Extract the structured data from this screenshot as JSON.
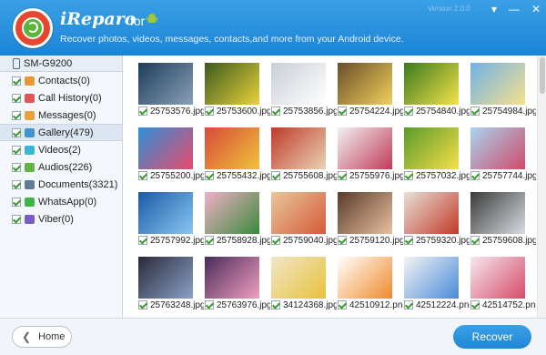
{
  "header": {
    "title": "iReparo",
    "for_text": "for",
    "subtitle": "Recover photos, videos, messages, contacts,and more from your Android device.",
    "version": "Version 2.0.0",
    "window_controls": {
      "menu": "▾",
      "minimize": "—",
      "close": "✕"
    }
  },
  "sidebar": {
    "device": "SM-G9200",
    "items": [
      {
        "label": "Contacts(0)",
        "icon": "contacts-icon",
        "color": "#e8963a"
      },
      {
        "label": "Call History(0)",
        "icon": "call-history-icon",
        "color": "#e05555"
      },
      {
        "label": "Messages(0)",
        "icon": "messages-icon",
        "color": "#e8a23a"
      },
      {
        "label": "Gallery(479)",
        "icon": "gallery-icon",
        "color": "#3d93d4",
        "active": true
      },
      {
        "label": "Videos(2)",
        "icon": "videos-icon",
        "color": "#3db4d4"
      },
      {
        "label": "Audios(226)",
        "icon": "audios-icon",
        "color": "#5fb53d"
      },
      {
        "label": "Documents(3321)",
        "icon": "documents-icon",
        "color": "#5e7c93"
      },
      {
        "label": "WhatsApp(0)",
        "icon": "whatsapp-icon",
        "color": "#3fb34a"
      },
      {
        "label": "Viber(0)",
        "icon": "viber-icon",
        "color": "#7b5cc6"
      }
    ]
  },
  "gallery": {
    "files": [
      {
        "name": "25753576.jpg",
        "colors": [
          "#1e3b5a",
          "#8aa2b8"
        ]
      },
      {
        "name": "25753600.jpg",
        "colors": [
          "#3c5a1e",
          "#e8d23a"
        ]
      },
      {
        "name": "25753856.jpg",
        "colors": [
          "#c9cfd6",
          "#ffffff"
        ]
      },
      {
        "name": "25754224.jpg",
        "colors": [
          "#6a4e2a",
          "#f0d05a"
        ]
      },
      {
        "name": "25754840.jpg",
        "colors": [
          "#3a7a1e",
          "#f4e24a"
        ]
      },
      {
        "name": "25754984.jpg",
        "colors": [
          "#6fb2e8",
          "#f6e08a"
        ]
      },
      {
        "name": "25755200.jpg",
        "colors": [
          "#2e8fd8",
          "#e84a6a"
        ]
      },
      {
        "name": "25755432.jpg",
        "colors": [
          "#d84a3a",
          "#f0c23a"
        ]
      },
      {
        "name": "25755608.jpg",
        "colors": [
          "#c03a2a",
          "#e9d3b3"
        ]
      },
      {
        "name": "25755976.jpg",
        "colors": [
          "#f2f2f2",
          "#c23a5a"
        ]
      },
      {
        "name": "25757032.jpg",
        "colors": [
          "#5a9a2a",
          "#f6e04a"
        ]
      },
      {
        "name": "25757744.jpg",
        "colors": [
          "#a8d4f0",
          "#d04a6a"
        ]
      },
      {
        "name": "25757992.jpg",
        "colors": [
          "#1a5aa8",
          "#8ac6f0"
        ]
      },
      {
        "name": "25758928.jpg",
        "colors": [
          "#f0b0c8",
          "#3a8a3a"
        ]
      },
      {
        "name": "25759040.jpg",
        "colors": [
          "#e8c89a",
          "#d65a3a"
        ]
      },
      {
        "name": "25759120.jpg",
        "colors": [
          "#5a3a2a",
          "#e8c0a0"
        ]
      },
      {
        "name": "25759320.jpg",
        "colors": [
          "#e8e0d8",
          "#c23a2a"
        ]
      },
      {
        "name": "25759608.jpg",
        "colors": [
          "#3a3a3a",
          "#d8dde2"
        ]
      },
      {
        "name": "25763248.jpg",
        "colors": [
          "#2a2a3a",
          "#8aa2c8"
        ]
      },
      {
        "name": "25763976.jpg",
        "colors": [
          "#4a2a5a",
          "#f0a0c0"
        ]
      },
      {
        "name": "34124368.jpg",
        "colors": [
          "#f0e6c8",
          "#e8c23a"
        ]
      },
      {
        "name": "42510912.png",
        "colors": [
          "#ffffff",
          "#f08a2a"
        ]
      },
      {
        "name": "42512224.png",
        "colors": [
          "#f4f4f4",
          "#4a8ad8"
        ]
      },
      {
        "name": "42514752.png",
        "colors": [
          "#f6e8ee",
          "#d84a6a"
        ]
      }
    ]
  },
  "footer": {
    "home_label": "Home",
    "recover_label": "Recover"
  }
}
